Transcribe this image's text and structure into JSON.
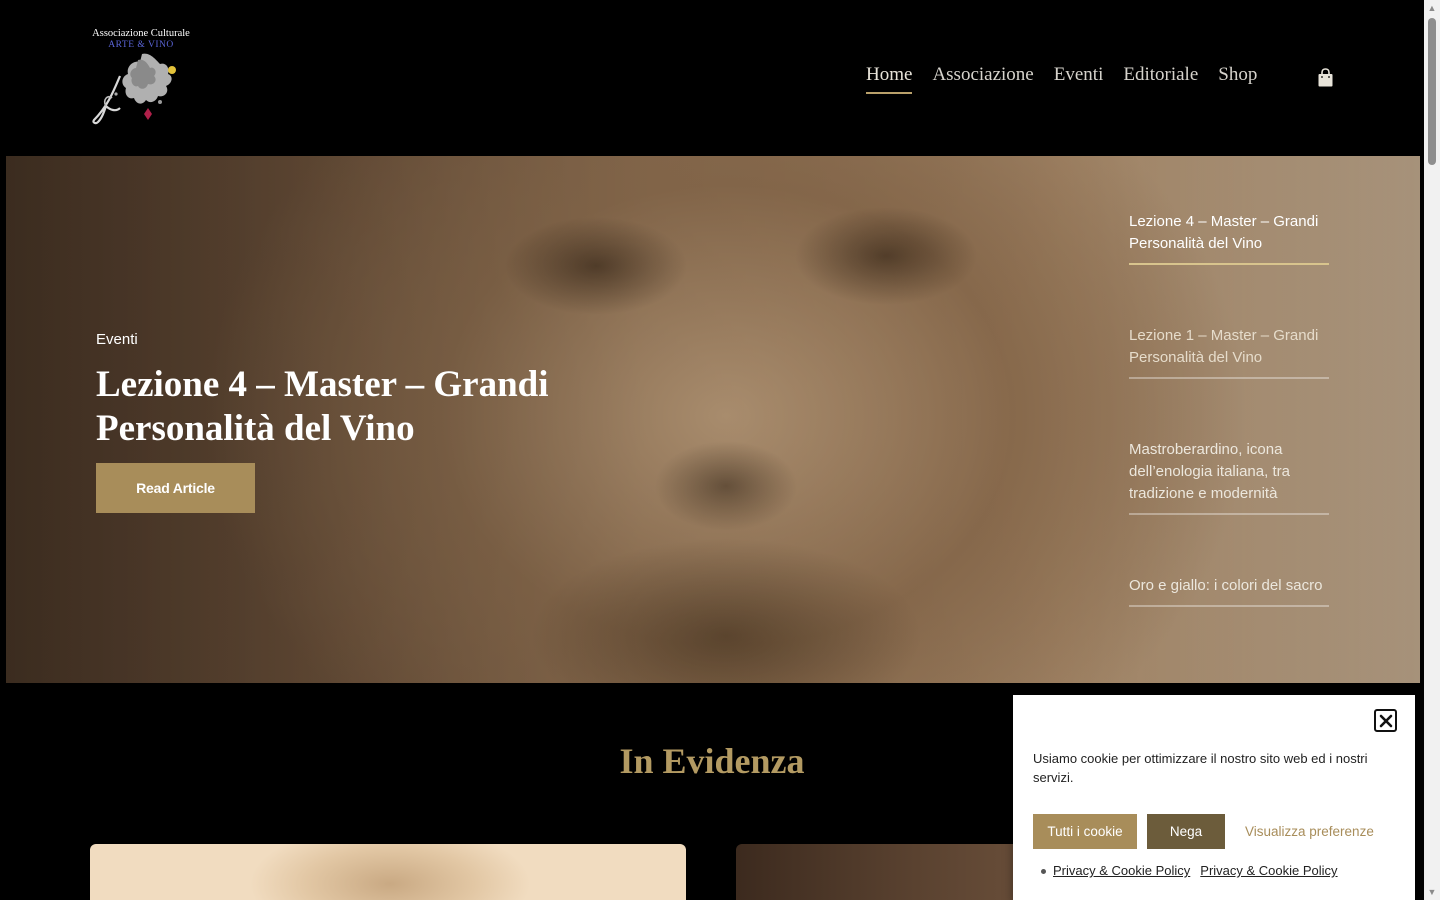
{
  "logo": {
    "line1": "Associazione Culturale",
    "line2": "ARTE & VINO"
  },
  "nav": {
    "items": [
      {
        "label": "Home",
        "active": true
      },
      {
        "label": "Associazione",
        "active": false
      },
      {
        "label": "Eventi",
        "active": false
      },
      {
        "label": "Editoriale",
        "active": false
      },
      {
        "label": "Shop",
        "active": false
      }
    ],
    "cart_icon": "shopping-bag-icon"
  },
  "hero": {
    "category": "Eventi",
    "title": "Lezione 4 – Master – Grandi Personalità del Vino",
    "button_label": "Read Article",
    "side_articles": [
      {
        "title": "Lezione 4 – Master – Grandi Personalità del Vino",
        "active": true
      },
      {
        "title": "Lezione 1 – Master – Grandi Personalità del Vino",
        "active": false
      },
      {
        "title": "Mastroberardino, icona dell’enologia italiana, tra tradizione e modernità",
        "active": false
      },
      {
        "title": "Oro e giallo: i colori del sacro",
        "active": false
      }
    ]
  },
  "featured": {
    "title": "In Evidenza"
  },
  "cookie": {
    "text": "Usiamo cookie per ottimizzare il nostro sito web ed i nostri servizi.",
    "accept_label": "Tutti i cookie",
    "deny_label": "Nega",
    "prefs_label": "Visualizza preferenze",
    "links": [
      "Privacy & Cookie Policy",
      "Privacy & Cookie Policy"
    ],
    "close_icon": "close-icon"
  },
  "colors": {
    "accent": "#a88d5a",
    "accent_dark": "#6c5c3b",
    "section_title": "#b39a62",
    "background": "#000000"
  }
}
